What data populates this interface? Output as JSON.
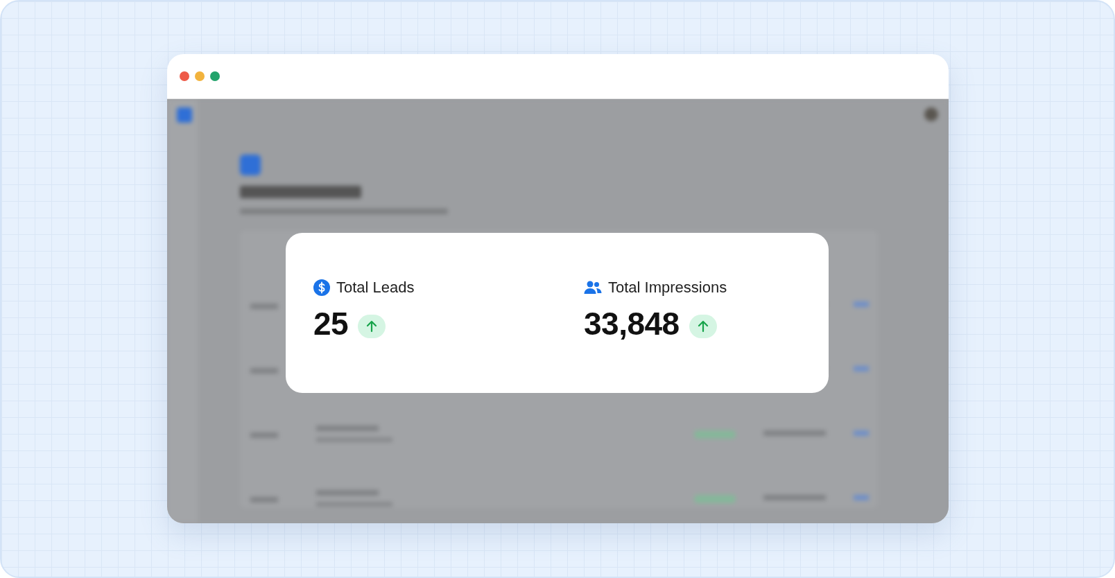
{
  "stats": [
    {
      "kind": "currency",
      "label": "Total Leads",
      "value": "25",
      "trending_up": true
    },
    {
      "kind": "people",
      "label": "Total Impressions",
      "value": "33,848",
      "trending_up": true
    }
  ]
}
